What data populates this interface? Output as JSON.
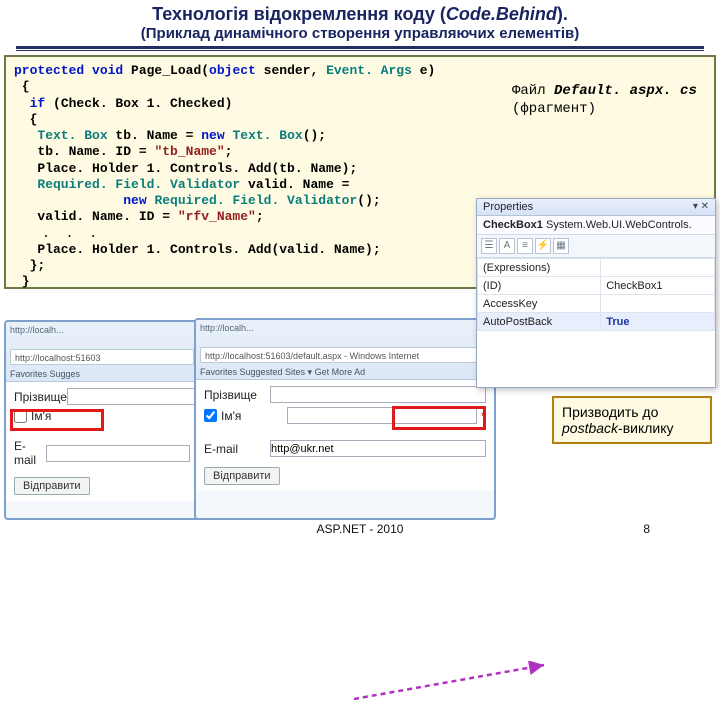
{
  "title_pre": "Технологія відокремлення коду (",
  "title_ital": "Code.Behind",
  "title_post": ").",
  "subtitle": "(Приклад динамічного створення управляючих елементів)",
  "file_label_pre": "Файл ",
  "file_name": "Default. aspx. cs",
  "file_frag": "(фрагмент)",
  "code": {
    "l1a": "protected void",
    "l1b": "Page_Load(",
    "l1c": "object",
    "l1d": " sender, ",
    "l1e": "Event. Args",
    "l1f": " e)",
    "l2": " {",
    "l3a": "  if",
    "l3b": " (Check. Box 1. Checked)",
    "l4": "  {",
    "l5a": "   Text. Box",
    "l5b": " tb. Name = ",
    "l5c": "new ",
    "l5d": "Text. Box",
    "l5e": "();",
    "l6a": "   tb. Name. ID = ",
    "l6b": "\"tb_Name\"",
    "l6c": ";",
    "l7": "   Place. Holder 1. Controls. Add(tb. Name);",
    "l8a": "   Required. Field. Validator",
    "l8b": " valid. Name =",
    "l9a": "              new ",
    "l9b": "Required. Field. Validator",
    "l9c": "();",
    "l10a": "   valid. Name. ID = ",
    "l10b": "\"rfv_Name\"",
    "l10c": ";",
    "dots": ". . .",
    "l12": "   Place. Holder 1. Controls. Add(valid. Name);",
    "l13": "  };",
    "l14": " }"
  },
  "browserA": {
    "addr": "http://localhost:51603",
    "tab": "http://localh...",
    "tools": "Favorites   Sugges",
    "lbl_surname": "Прізвище",
    "lbl_name": "Ім'я",
    "lbl_email": "E-mail",
    "btn": "Відправити"
  },
  "browserB": {
    "addr": "http://localhost:51603/default.aspx - Windows Internet",
    "tab": "http://localh...",
    "tools": "Favorites   Suggested Sites ▾   Get More Ad",
    "lbl_surname": "Прізвище",
    "lbl_name": "Ім'я",
    "lbl_email": "E-mail",
    "val_email": "http@ukr.net",
    "btn": "Відправити",
    "warn": "*"
  },
  "props": {
    "title": "Properties",
    "close": "▾ ✕",
    "obj_ctrl": "CheckBox1",
    "obj_type": " System.Web.UI.WebControls.",
    "icons": [
      "☰",
      "A",
      "≡",
      "⚡",
      "▦"
    ],
    "rows": [
      {
        "k": "(Expressions)",
        "v": ""
      },
      {
        "k": "(ID)",
        "v": "CheckBox1"
      },
      {
        "k": "AccessKey",
        "v": ""
      },
      {
        "k": "AutoPostBack",
        "v": "True",
        "sel": true
      }
    ]
  },
  "callout_l1": "Призводить до ",
  "callout_pb": "postback",
  "callout_l2": "-виклику",
  "footer": "ASP.NET - 2010",
  "slidenum": "8"
}
